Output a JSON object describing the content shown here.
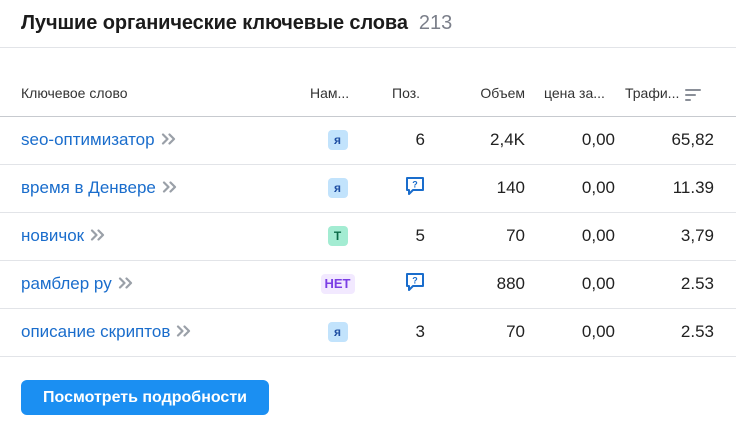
{
  "widget": {
    "title": "Лучшие органические ключевые слова",
    "count": "213"
  },
  "table": {
    "headers": {
      "keyword": "Ключевое слово",
      "intent": "Нам...",
      "position": "Поз.",
      "volume": "Объем",
      "cpc": "цена за...",
      "traffic": "Трафи..."
    },
    "rows": [
      {
        "keyword": "seo-оптимизатор",
        "intent": "я",
        "intent_type": "ya",
        "position": "6",
        "position_type": "number",
        "volume": "2,4K",
        "cpc": "0,00",
        "traffic": "65,82"
      },
      {
        "keyword": "время в Денвере",
        "intent": "я",
        "intent_type": "ya",
        "position": "",
        "position_type": "serp-feature-icon",
        "volume": "140",
        "cpc": "0,00",
        "traffic": "11.39"
      },
      {
        "keyword": "новичок",
        "intent": "Т",
        "intent_type": "t",
        "position": "5",
        "position_type": "number",
        "volume": "70",
        "cpc": "0,00",
        "traffic": "3,79"
      },
      {
        "keyword": "рамблер ру",
        "intent": "НЕТ",
        "intent_type": "net",
        "position": "",
        "position_type": "serp-feature-icon",
        "volume": "880",
        "cpc": "0,00",
        "traffic": "2.53"
      },
      {
        "keyword": "описание скриптов",
        "intent": "я",
        "intent_type": "ya",
        "position": "3",
        "position_type": "number",
        "volume": "70",
        "cpc": "0,00",
        "traffic": "2.53"
      }
    ]
  },
  "footer": {
    "details_button": "Посмотреть подробности"
  },
  "colors": {
    "link": "#1a6dcc",
    "button": "#1b8ff2",
    "badge_ya_bg": "#c2e3fc",
    "badge_t_bg": "#a3ecd2",
    "badge_net_bg": "#f2e9ff",
    "serp_icon": "#1a6dcc"
  }
}
